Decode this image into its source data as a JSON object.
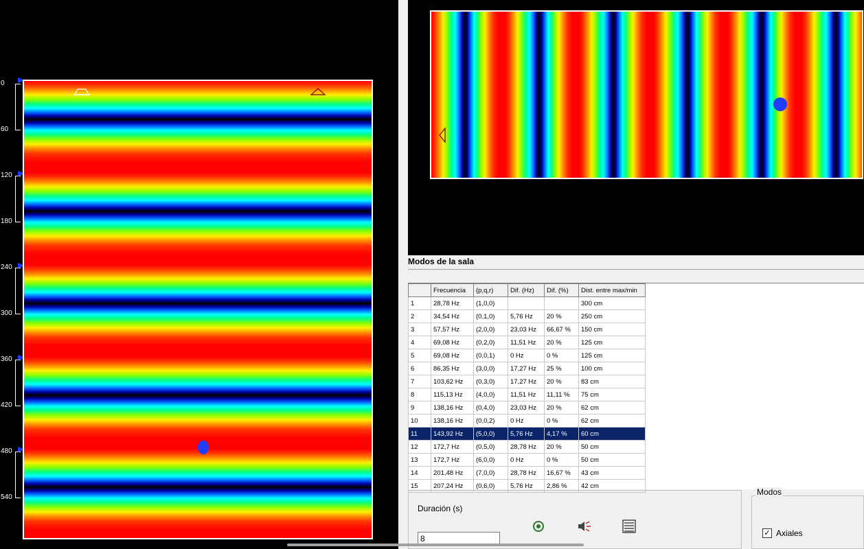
{
  "ruler": {
    "labels": [
      "0",
      "60",
      "120",
      "180",
      "240",
      "300",
      "360",
      "420",
      "480",
      "540"
    ]
  },
  "modes": {
    "title": "Modos de la sala",
    "columns": [
      "",
      "Frecuencia",
      "(p,q,r)",
      "Dif. (Hz)",
      "Dif. (%)",
      "Dist. entre max/min"
    ],
    "rows": [
      [
        "1",
        "28,78 Hz",
        "(1,0,0)",
        "",
        "",
        "300 cm"
      ],
      [
        "2",
        "34,54 Hz",
        "(0,1,0)",
        "5,76 Hz",
        "20 %",
        "250 cm"
      ],
      [
        "3",
        "57,57 Hz",
        "(2,0,0)",
        "23,03 Hz",
        "66,67 %",
        "150 cm"
      ],
      [
        "4",
        "69,08 Hz",
        "(0,2,0)",
        "11,51 Hz",
        "20 %",
        "125 cm"
      ],
      [
        "5",
        "69,08 Hz",
        "(0,0,1)",
        "0 Hz",
        "0 %",
        "125 cm"
      ],
      [
        "6",
        "86,35 Hz",
        "(3,0,0)",
        "17,27 Hz",
        "25 %",
        "100 cm"
      ],
      [
        "7",
        "103,62 Hz",
        "(0,3,0)",
        "17,27 Hz",
        "20 %",
        "83 cm"
      ],
      [
        "8",
        "115,13 Hz",
        "(4,0,0)",
        "11,51 Hz",
        "11,11 %",
        "75 cm"
      ],
      [
        "9",
        "138,16 Hz",
        "(0,4,0)",
        "23,03 Hz",
        "20 %",
        "62 cm"
      ],
      [
        "10",
        "138,16 Hz",
        "(0,0,2)",
        "0 Hz",
        "0 %",
        "62 cm"
      ],
      [
        "11",
        "143,92 Hz",
        "(5,0,0)",
        "5,76 Hz",
        "4,17 %",
        "60 cm"
      ],
      [
        "12",
        "172,7 Hz",
        "(0,5,0)",
        "28,78 Hz",
        "20 %",
        "50 cm"
      ],
      [
        "13",
        "172,7 Hz",
        "(6,0,0)",
        "0 Hz",
        "0 %",
        "50 cm"
      ],
      [
        "14",
        "201,48 Hz",
        "(7,0,0)",
        "28,78 Hz",
        "16,67 %",
        "43 cm"
      ],
      [
        "15",
        "207,24 Hz",
        "(0,6,0)",
        "5,76 Hz",
        "2,86 %",
        "42 cm"
      ]
    ],
    "selected_row": 11
  },
  "duration": {
    "label": "Duración (s)",
    "value": "8"
  },
  "modos_group": {
    "legend": "Modos",
    "axiales_label": "Axiales",
    "axiales_checked": true
  },
  "colors": {
    "selection": "#0a246a",
    "listener": "#1f3cff",
    "marker": "#1f3cff"
  },
  "icons": [
    "listen-icon",
    "speaker-sound-icon",
    "list-view-icon"
  ]
}
